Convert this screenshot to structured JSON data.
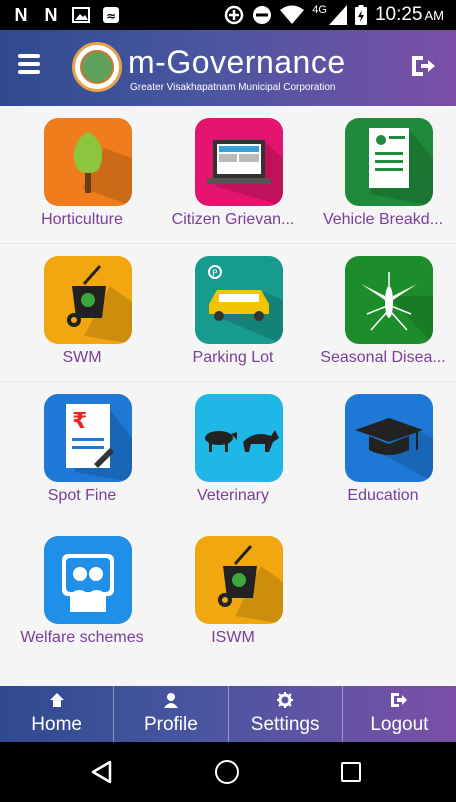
{
  "status_bar": {
    "time": "10:25",
    "ampm": "AM",
    "network": "4G",
    "left_icons": [
      "n-notification-icon",
      "n-notification-icon",
      "image-icon",
      "cast-icon"
    ],
    "right_icons": [
      "data-saver-icon",
      "do-not-disturb-icon",
      "wifi-icon",
      "signal-icon",
      "battery-icon"
    ]
  },
  "header": {
    "title": "m-Governance",
    "subtitle": "Greater Visakhapatnam Municipal Corporation"
  },
  "tiles": [
    {
      "label": "Horticulture",
      "icon": "tree-icon",
      "color": "#f07d1d"
    },
    {
      "label": "Citizen Grievan...",
      "icon": "laptop-icon",
      "color": "#e3156e"
    },
    {
      "label": "Vehicle Breakd...",
      "icon": "document-icon",
      "color": "#1f8a3a"
    },
    {
      "label": "SWM",
      "icon": "waste-bin-icon",
      "color": "#f2a710"
    },
    {
      "label": "Parking Lot",
      "icon": "car-icon",
      "color": "#179b8e"
    },
    {
      "label": "Seasonal Disea...",
      "icon": "mosquito-icon",
      "color": "#1d8c2a"
    },
    {
      "label": "Spot Fine",
      "icon": "rupee-bill-icon",
      "color": "#1e78d6"
    },
    {
      "label": "Veterinary",
      "icon": "animals-icon",
      "color": "#1fb7e6"
    },
    {
      "label": "Education",
      "icon": "graduation-cap-icon",
      "color": "#1e78d6"
    },
    {
      "label": "Welfare schemes",
      "icon": "welfare-icon",
      "color": "#1f8fe8"
    },
    {
      "label": "ISWM",
      "icon": "waste-bin-icon",
      "color": "#f2a710"
    }
  ],
  "bottom_nav": [
    {
      "label": "Home",
      "icon": "home-icon"
    },
    {
      "label": "Profile",
      "icon": "person-icon"
    },
    {
      "label": "Settings",
      "icon": "gear-icon"
    },
    {
      "label": "Logout",
      "icon": "logout-icon"
    }
  ],
  "system_nav": [
    "back-icon",
    "home-circle-icon",
    "recents-icon"
  ]
}
